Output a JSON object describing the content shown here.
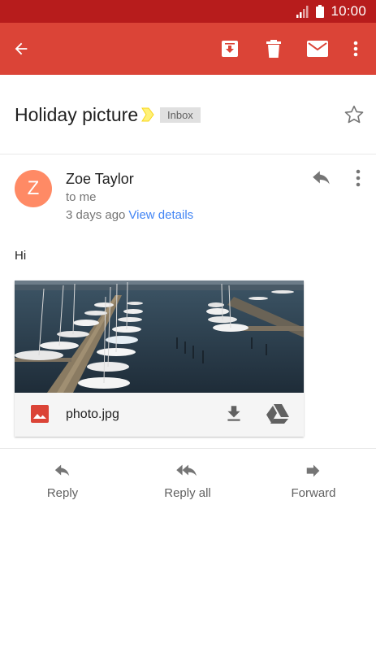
{
  "status_bar": {
    "time": "10:00",
    "signal_icon": "signal-icon",
    "battery_icon": "battery-icon"
  },
  "toolbar": {
    "back_icon": "arrow-back-icon",
    "archive_icon": "archive-icon",
    "delete_icon": "trash-icon",
    "mark_unread_icon": "mail-icon",
    "more_icon": "more-vert-icon"
  },
  "email": {
    "subject": "Holiday picture",
    "label": "Inbox",
    "star_icon": "star-outline-icon",
    "sender": {
      "initial": "Z",
      "name": "Zoe Taylor",
      "recipient": "to me",
      "time": "3 days ago",
      "view_details": "View details"
    },
    "body": "Hi",
    "attachment": {
      "file_name": "photo.jpg",
      "file_icon": "image-file-icon",
      "download_icon": "download-icon",
      "drive_icon": "drive-icon"
    }
  },
  "actions": {
    "reply": "Reply",
    "reply_all": "Reply all",
    "forward": "Forward"
  },
  "colors": {
    "status_bar": "#b71c1c",
    "app_bar": "#db4437",
    "avatar": "#ff8a65",
    "link": "#4285f4"
  }
}
